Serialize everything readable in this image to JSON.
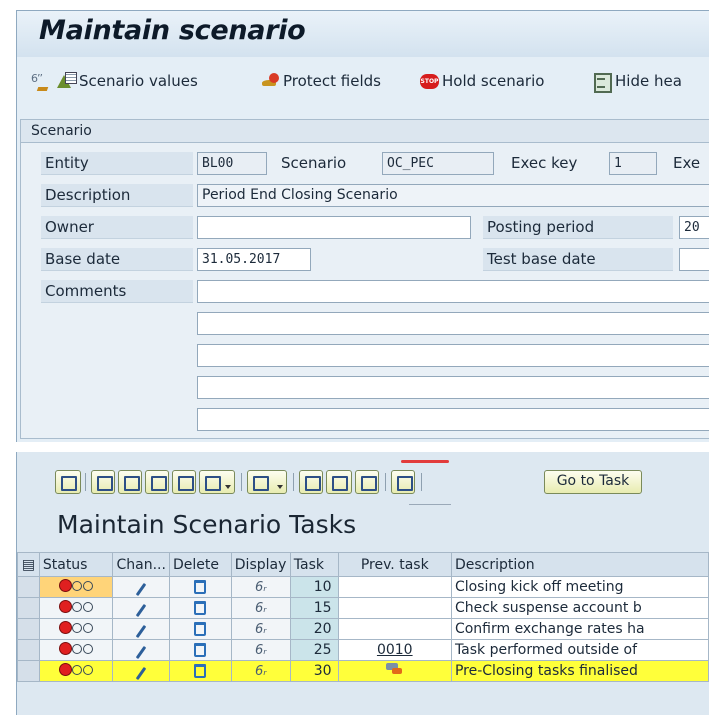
{
  "title": "Maintain scenario",
  "toolbar": {
    "scenario_values": "Scenario values",
    "protect_fields": "Protect fields",
    "hold_scenario": "Hold scenario",
    "hide_header": "Hide hea"
  },
  "scenario": {
    "group_title": "Scenario",
    "entity_label": "Entity",
    "entity_value": "BL00",
    "scenario_label": "Scenario",
    "scenario_value": "OC_PEC",
    "exec_key_label": "Exec key",
    "exec_key_value": "1",
    "exe_label_cut": "Exe",
    "description_label": "Description",
    "description_value": "Period End Closing Scenario",
    "owner_label": "Owner",
    "owner_value": "",
    "posting_period_label": "Posting period",
    "posting_period_value": "20",
    "base_date_label": "Base date",
    "base_date_value": "31.05.2017",
    "test_base_date_label": "Test base date",
    "test_base_date_value": "",
    "comments_label": "Comments"
  },
  "alv": {
    "go_to_task": "Go to Task"
  },
  "grid": {
    "title": "Maintain Scenario Tasks",
    "columns": [
      "Status",
      "Chan...",
      "Delete",
      "Display",
      "Task",
      "Prev. task",
      "Description"
    ],
    "rows": [
      {
        "task": "10",
        "prev_task": "",
        "description": "Closing kick off meeting",
        "highlight_status": true,
        "highlight_row": false,
        "prev_icon": false
      },
      {
        "task": "15",
        "prev_task": "",
        "description": "Check suspense account b",
        "highlight_status": false,
        "highlight_row": false,
        "prev_icon": false
      },
      {
        "task": "20",
        "prev_task": "",
        "description": "Confirm exchange rates ha",
        "highlight_status": false,
        "highlight_row": false,
        "prev_icon": false
      },
      {
        "task": "25",
        "prev_task": "0010",
        "description": "Task performed outside of",
        "highlight_status": false,
        "highlight_row": false,
        "prev_icon": false
      },
      {
        "task": "30",
        "prev_task": "",
        "description": "Pre-Closing tasks finalised",
        "highlight_status": false,
        "highlight_row": true,
        "prev_icon": true
      }
    ]
  },
  "colors": {
    "row_highlight": "#ffff3a",
    "status_highlight": "#ffd479",
    "task_cell": "#cbe4ea",
    "status_red": "#e02020"
  }
}
